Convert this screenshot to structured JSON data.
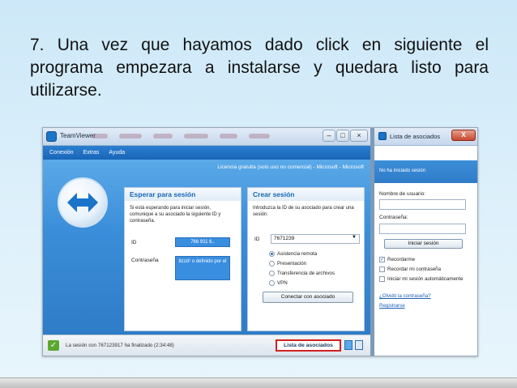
{
  "caption": "7. Una vez que hayamos dado click en siguiente el programa empezara a instalarse y quedara listo para utilizarse.",
  "teamviewer": {
    "title": "TeamViewer",
    "menu": [
      "Conexión",
      "Extras",
      "Ayuda"
    ],
    "license": "Licencia gratuita (solo uso no comercial) - Microsoft - Microsoft",
    "wait_session": {
      "heading": "Esperar para sesión",
      "text": "Si está esperando para iniciar sesión, comunique a su asociado la siguiente ID y contraseña.",
      "id_label": "ID",
      "id_value": "766 911 6..",
      "password_label": "Contraseña",
      "password_value": "8zzd¹ o definido por el"
    },
    "create_session": {
      "heading": "Crear sesión",
      "text": "Introduzca la ID de su asociado para crear una sesión.",
      "id_label": "ID",
      "id_value": "7671239",
      "options": [
        "Asistencia remota",
        "Presentación",
        "Transferencia de archivos",
        "VPN"
      ],
      "selected_option": "Asistencia remota",
      "connect_button": "Conectar con asociado"
    },
    "status": "La sesión con 767123917 ha finalizado (2:34:48)",
    "partners_button": "Lista de asociados"
  },
  "partner_list": {
    "title": "Lista de asociados",
    "close": "X",
    "banner": "No ha iniciado sesión",
    "username_label": "Nombre de usuario:",
    "password_label": "Contraseña:",
    "login_button": "Iniciar sesión",
    "checkboxes": [
      {
        "label": "Recordarme",
        "checked": true
      },
      {
        "label": "Recordar mi contraseña",
        "checked": false
      },
      {
        "label": "Iniciar mi sesión automáticamente",
        "checked": false
      }
    ],
    "forgot_link": "¿Olvidó la contraseña?",
    "register_link": "Registrarse"
  },
  "colors": {
    "accent": "#2f7cc7",
    "status_ok": "#5aa830",
    "highlight": "#d22020"
  }
}
